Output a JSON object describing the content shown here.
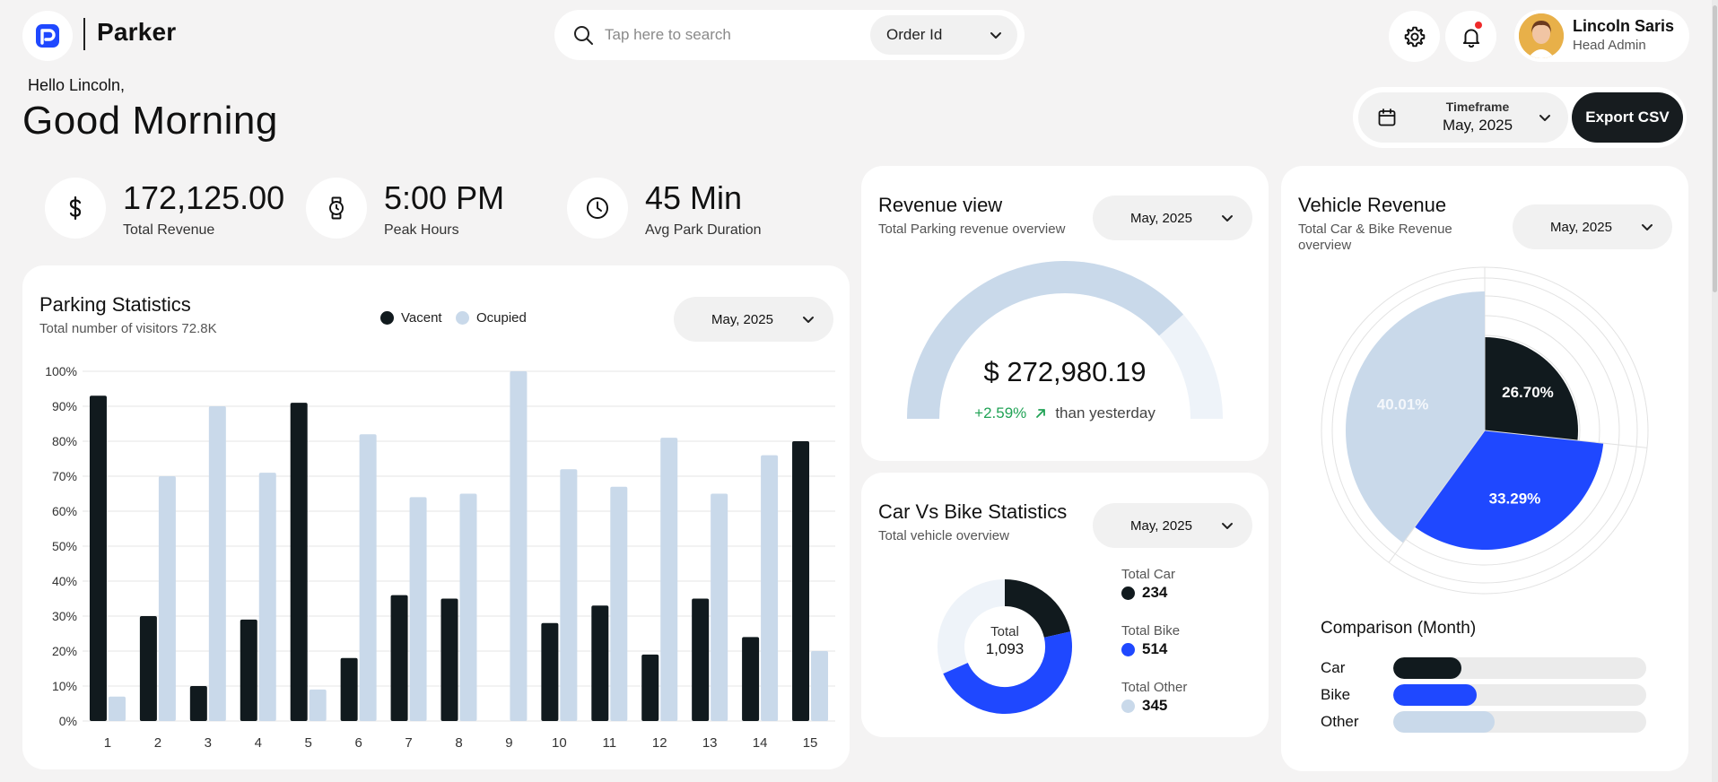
{
  "brand": {
    "name": "Parker"
  },
  "search": {
    "placeholder": "Tap here to search",
    "filter": "Order Id"
  },
  "user": {
    "name": "Lincoln Saris",
    "role": "Head Admin"
  },
  "greeting": {
    "hello": "Hello Lincoln,",
    "title": "Good Morning"
  },
  "timeframe": {
    "label": "Timeframe",
    "value": "May, 2025"
  },
  "export_label": "Export CSV",
  "stats": [
    {
      "value": "172,125.00",
      "label": "Total Revenue",
      "icon": "dollar-icon"
    },
    {
      "value": "5:00 PM",
      "label": "Peak Hours",
      "icon": "watch-icon"
    },
    {
      "value": "45 Min",
      "label": "Avg Park Duration",
      "icon": "clock-icon"
    }
  ],
  "parking": {
    "title": "Parking Statistics",
    "subtitle": "Total number of visitors 72.8K",
    "period": "May, 2025",
    "legend": [
      "Vacent",
      "Ocupied"
    ]
  },
  "revenue": {
    "title": "Revenue view",
    "subtitle": "Total Parking revenue overview",
    "period": "May, 2025",
    "amount": "$ 272,980.19",
    "change": "+2.59%",
    "change_note": "than yesterday",
    "gauge_fraction": 0.77
  },
  "carbike": {
    "title": "Car Vs Bike Statistics",
    "subtitle": "Total vehicle overview",
    "period": "May, 2025",
    "center_label": "Total",
    "center_value": "1,093",
    "items": [
      {
        "label": "Total Car",
        "value": "234"
      },
      {
        "label": "Total Bike",
        "value": "514"
      },
      {
        "label": "Total Other",
        "value": "345"
      }
    ]
  },
  "vehicle": {
    "title": "Vehicle Revenue",
    "subtitle": "Total Car & Bike Revenue overview",
    "period": "May, 2025",
    "comparison_title": "Comparison (Month)",
    "comparison": [
      {
        "label": "Car",
        "fraction": 0.27
      },
      {
        "label": "Bike",
        "fraction": 0.33
      },
      {
        "label": "Other",
        "fraction": 0.4
      }
    ]
  },
  "colors": {
    "dark": "#111a1e",
    "light": "#c9d9ea",
    "blue": "#1f48ff",
    "pale": "#eef3f9",
    "green": "#21a356"
  },
  "chart_data": [
    {
      "type": "bar",
      "title": "Parking Statistics",
      "categories": [
        "1",
        "2",
        "3",
        "4",
        "5",
        "6",
        "7",
        "8",
        "9",
        "10",
        "11",
        "12",
        "13",
        "14",
        "15"
      ],
      "yticks": [
        "0%",
        "10%",
        "20%",
        "30%",
        "40%",
        "50%",
        "60%",
        "70%",
        "80%",
        "90%",
        "100%"
      ],
      "ylim": [
        0,
        100
      ],
      "grid": true,
      "series": [
        {
          "name": "Vacent",
          "values": [
            93,
            30,
            10,
            29,
            91,
            18,
            36,
            35,
            0,
            28,
            33,
            19,
            35,
            24,
            80
          ]
        },
        {
          "name": "Ocupied",
          "values": [
            7,
            70,
            90,
            71,
            9,
            82,
            64,
            65,
            100,
            72,
            67,
            81,
            65,
            76,
            20
          ]
        }
      ]
    },
    {
      "type": "pie",
      "title": "Car Vs Bike Statistics",
      "labels": [
        "Total Car",
        "Total Bike",
        "Total Other"
      ],
      "values": [
        234,
        514,
        345
      ]
    },
    {
      "type": "pie",
      "title": "Vehicle Revenue",
      "labels": [
        "26.70%",
        "33.29%",
        "40.01%"
      ],
      "values": [
        26.7,
        33.29,
        40.01
      ]
    }
  ]
}
